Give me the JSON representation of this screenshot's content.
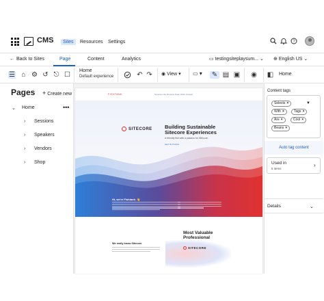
{
  "topbar": {
    "app_title": "CMS",
    "nav": [
      "Sites",
      "Resources",
      "Settings"
    ],
    "active_nav": "Sites"
  },
  "tabbar": {
    "back_label": "Back to Sites",
    "tabs": [
      "Page",
      "Content",
      "Analytics"
    ],
    "active_tab": "Page",
    "site_select": "testingsiteplaysum...",
    "language_select": "English US"
  },
  "toolbar": {
    "page_name": "Home",
    "page_template": "Default experience",
    "view_label": "View",
    "right_title": "Home"
  },
  "left_panel": {
    "title": "Pages",
    "create_new": "Create new",
    "root": "Home",
    "children": [
      "Sessions",
      "Speakers",
      "Vendors",
      "Shop"
    ]
  },
  "site_preview": {
    "logo_text": "FISHTANK",
    "nav_links": "Services   Our Process   Team   Work   Contact",
    "badge": "SITECORE",
    "hero_title": "Building Sustainable Sitecore Experiences",
    "hero_sub": "A friendly fish with a passion for Sitecore.",
    "hero_cta": "GET IN TOUCH",
    "hero_hi": "Hi, we're Fishtank. 👋",
    "know_title": "We really know Sitecore",
    "mvp_title": "Most Valuable Professional",
    "mvp_badge": "SITECORE"
  },
  "right_panel": {
    "content_tags_label": "Content tags",
    "tags": [
      "Selects",
      "With",
      "Tags",
      "Are",
      "Cool",
      "Beans"
    ],
    "auto_tag": "Auto tag content",
    "used_in_title": "Used in",
    "used_in_count": "5 items",
    "details": "Details"
  },
  "colors": {
    "accent": "#1c5cc7",
    "sitecore_red": "#e0312f",
    "hero_blue": "#2b6bd6"
  },
  "icons": {
    "top_right": [
      "search-icon",
      "bell-icon",
      "help-icon"
    ],
    "toolbar": [
      "list-view-icon",
      "site-tree-icon",
      "settings-icon",
      "history-icon",
      "share-icon",
      "check-circle-icon",
      "undo-icon",
      "redo-icon",
      "eye-icon",
      "device-icon",
      "pencil-icon",
      "form-icon",
      "image-icon",
      "preview-icon",
      "panel-toggle-icon"
    ]
  }
}
